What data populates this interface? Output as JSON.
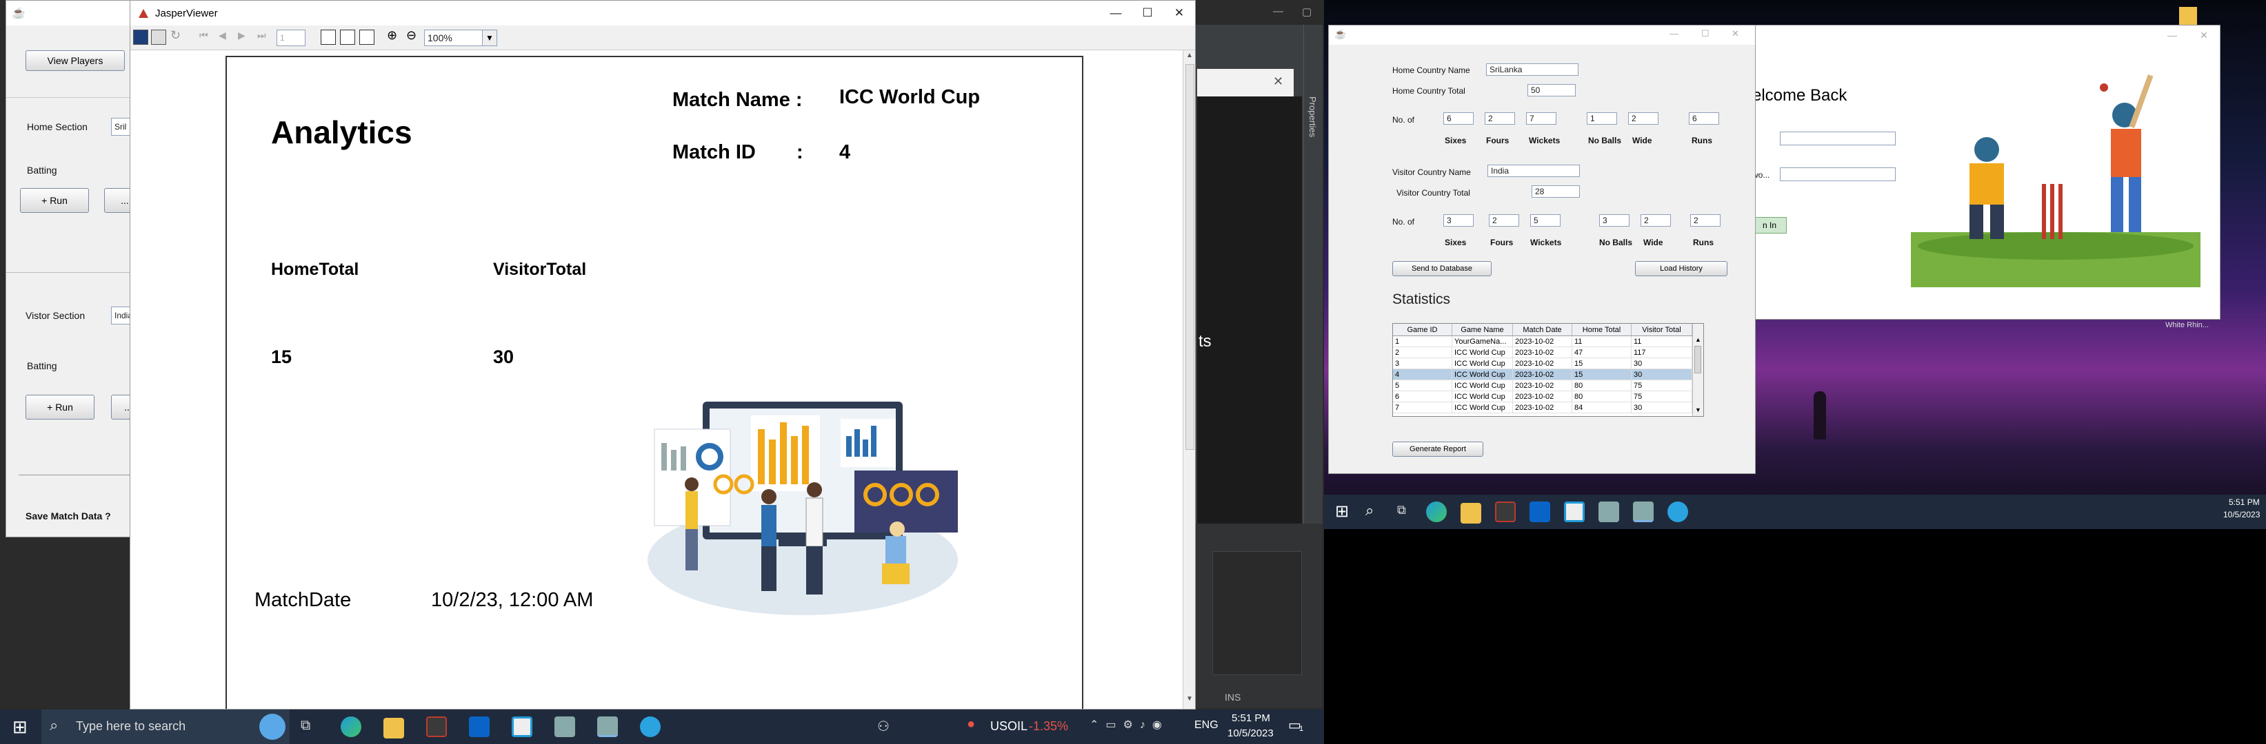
{
  "main_app": {
    "view_players": "View Players",
    "home_section": "Home Section",
    "home_input": "Sril",
    "batting1": "Batting",
    "run1": "+ Run",
    "dots1": "...",
    "visitor_section": "Vistor Section",
    "visitor_input": "India",
    "batting2": "Batting",
    "run2": "+ Run",
    "dots2": "...",
    "save_match": "Save Match Data ?"
  },
  "jasper": {
    "title": "JasperViewer",
    "page_field": "1",
    "zoom": "100%",
    "report": {
      "heading": "Analytics",
      "match_name_label": "Match Name :",
      "match_name_value": "ICC World Cup",
      "match_id_label": "Match ID",
      "match_id_colon": ":",
      "match_id_value": "4",
      "home_total_label": "HomeTotal",
      "visitor_total_label": "VisitorTotal",
      "home_total_value": "15",
      "visitor_total_value": "30",
      "match_date_label": "MatchDate",
      "match_date_value": "10/2/23, 12:00 AM"
    }
  },
  "ide_fragments": {
    "properties": "Properties",
    "ts": "ts",
    "ins": "INS"
  },
  "stats_window": {
    "home_country_name_label": "Home Country Name",
    "home_country_name": "SriLanka",
    "home_country_total_label": "Home Country Total",
    "home_country_total": "50",
    "no_of_label_1": "No. of",
    "home_fields": [
      "6",
      "2",
      "7",
      "1",
      "2",
      "6"
    ],
    "stat_labels": [
      "Sixes",
      "Fours",
      "Wickets",
      "No Balls",
      "Wide",
      "Runs"
    ],
    "visitor_country_name_label": "Visitor Country Name",
    "visitor_country_name": "India",
    "visitor_country_total_label": "Visitor Country Total",
    "visitor_country_total": "28",
    "no_of_label_2": "No. of",
    "visitor_fields": [
      "3",
      "2",
      "5",
      "3",
      "2",
      "2"
    ],
    "send_button": "Send to Database",
    "load_button": "Load History",
    "statistics_title": "Statistics",
    "table_headers": [
      "Game ID",
      "Game Name",
      "Match Date",
      "Home Total",
      "Visitor Total"
    ],
    "table_rows": [
      [
        "1",
        "YourGameNa...",
        "2023-10-02",
        "11",
        "11"
      ],
      [
        "2",
        "ICC World Cup",
        "2023-10-02",
        "47",
        "117"
      ],
      [
        "3",
        "ICC World Cup",
        "2023-10-02",
        "15",
        "30"
      ],
      [
        "4",
        "ICC World Cup",
        "2023-10-02",
        "15",
        "30"
      ],
      [
        "5",
        "ICC World Cup",
        "2023-10-02",
        "80",
        "75"
      ],
      [
        "6",
        "ICC World Cup",
        "2023-10-02",
        "80",
        "75"
      ],
      [
        "7",
        "ICC World Cup",
        "2023-10-02",
        "84",
        "30"
      ]
    ],
    "selected_row": 3,
    "generate_button": "Generate Report"
  },
  "login_window": {
    "welcome": "elcome Back",
    "field_label_2": "wo...",
    "login_button": "n In",
    "desktop_label": "White Rhin..."
  },
  "taskbar_left": {
    "search_placeholder": "Type here to search",
    "stock_name": "USOIL",
    "stock_change": "-1.35%",
    "language": "ENG",
    "time": "5:51 PM",
    "date": "10/5/2023",
    "notif_count": "1"
  },
  "taskbar_right": {
    "time": "5:51 PM",
    "date": "10/5/2023"
  },
  "colors": {
    "accent_blue": "#0a64c8",
    "taskbar": "#1f2b3c",
    "stock_red": "#e8524a",
    "row_selected": "#b8cfe5"
  }
}
